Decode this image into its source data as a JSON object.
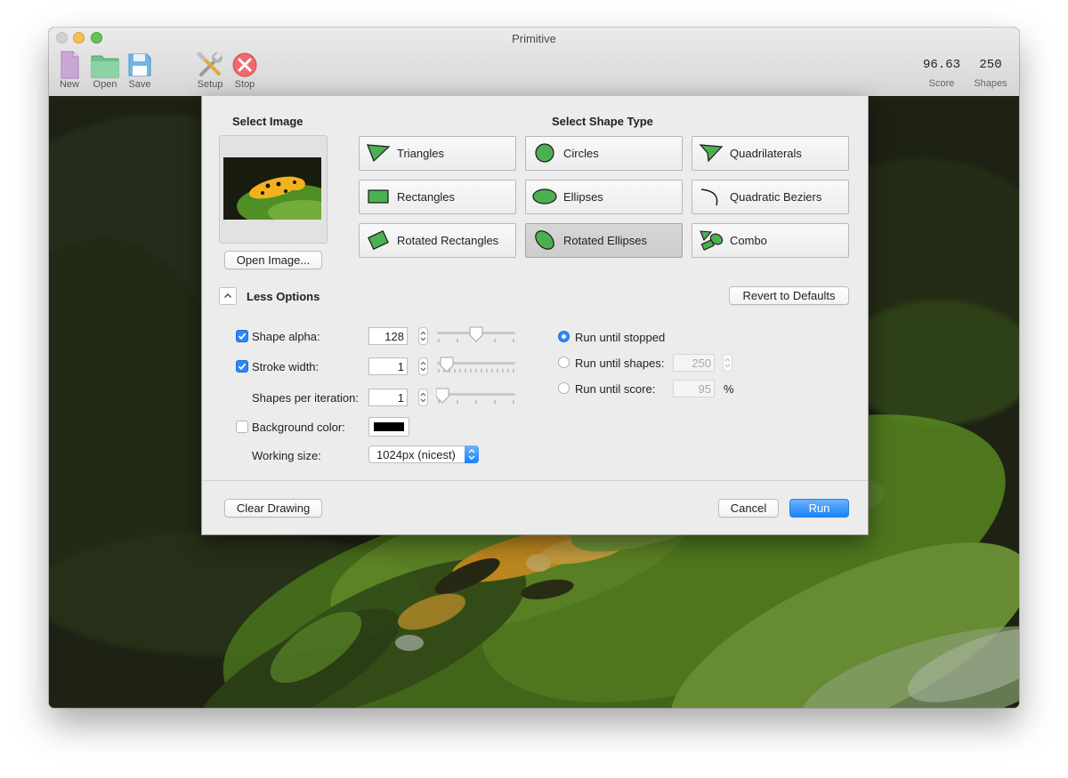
{
  "window": {
    "title": "Primitive"
  },
  "toolbar": {
    "new_label": "New",
    "open_label": "Open",
    "save_label": "Save",
    "setup_label": "Setup",
    "stop_label": "Stop"
  },
  "stats": {
    "score_value": "96.63",
    "score_label": "Score",
    "shapes_value": "250",
    "shapes_label": "Shapes"
  },
  "dialog": {
    "select_image_header": "Select Image",
    "open_image_label": "Open Image...",
    "select_shape_header": "Select Shape Type",
    "shape_types": [
      {
        "label": "Triangles",
        "icon": "triangle-icon"
      },
      {
        "label": "Circles",
        "icon": "circle-icon"
      },
      {
        "label": "Quadrilaterals",
        "icon": "quadrilateral-icon"
      },
      {
        "label": "Rectangles",
        "icon": "rectangle-icon"
      },
      {
        "label": "Ellipses",
        "icon": "ellipse-icon"
      },
      {
        "label": "Quadratic Beziers",
        "icon": "bezier-curve-icon"
      },
      {
        "label": "Rotated Rectangles",
        "icon": "rotated-rectangle-icon"
      },
      {
        "label": "Rotated Ellipses",
        "icon": "rotated-ellipse-icon"
      },
      {
        "label": "Combo",
        "icon": "combo-shapes-icon"
      }
    ],
    "selected_shape": "Rotated Ellipses",
    "less_options_label": "Less Options",
    "revert_label": "Revert to Defaults",
    "options": {
      "shape_alpha_label": "Shape alpha:",
      "shape_alpha_value": "128",
      "shape_alpha_checked": true,
      "stroke_width_label": "Stroke width:",
      "stroke_width_value": "1",
      "stroke_width_checked": true,
      "shapes_per_iteration_label": "Shapes per iteration:",
      "shapes_per_iteration_value": "1",
      "background_color_label": "Background color:",
      "background_color_checked": false,
      "background_color": "#000000",
      "working_size_label": "Working size:",
      "working_size_value": "1024px (nicest)"
    },
    "run_modes": {
      "until_stopped_label": "Run until stopped",
      "until_shapes_label": "Run until shapes:",
      "until_shapes_value": "250",
      "until_score_label": "Run until score:",
      "until_score_value": "95",
      "percent_label": "%",
      "selected": "Run until stopped"
    },
    "clear_label": "Clear Drawing",
    "cancel_label": "Cancel",
    "run_label": "Run"
  },
  "colors": {
    "accent": "#1a82fb",
    "shape_green": "#4caf50",
    "canvas_green": "#5a8f1e"
  }
}
